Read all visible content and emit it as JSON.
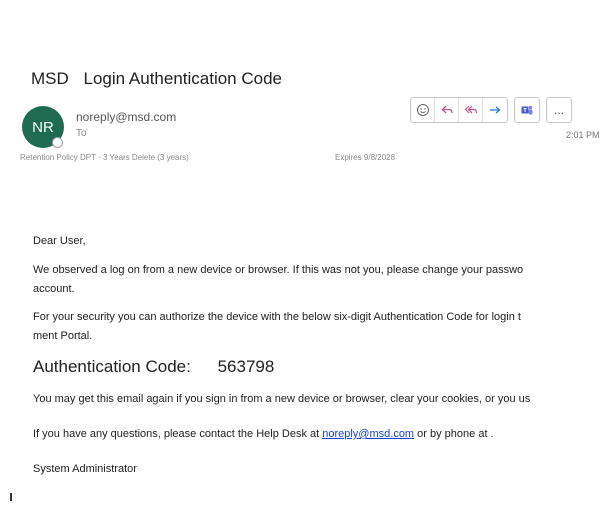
{
  "email": {
    "sender_tag": "MSD",
    "subject": "Login Authentication Code",
    "avatar_initials": "NR",
    "from": "noreply@msd.com",
    "to_label": "To",
    "retention": "Retention Policy  DPT - 3 Years Delete (3 years)",
    "expires": "Expires  9/8/2028",
    "time": "2:01 PM"
  },
  "toolbar": {
    "icons": [
      "emoji-icon",
      "reply-icon",
      "reply-all-icon",
      "forward-icon",
      "teams-icon",
      "more-icon"
    ],
    "more_label": "..."
  },
  "body": {
    "greeting": "Dear User,",
    "line1": "We observed a log on from a new device or browser. If this was not you, please change your passwo",
    "line1b": "account.",
    "line2": "For your security you can authorize the device with the below six-digit Authentication Code for login t",
    "line2b": "ment Portal.",
    "auth_label": "Authentication Code:",
    "auth_code": "563798",
    "line3": "You may get this email again if you sign in from a new device or browser, clear your cookies, or you us",
    "line4_pre": "If you have any questions, please contact the Help Desk at ",
    "line4_link": "noreply@msd.com",
    "line4_post": " or by phone at .",
    "signature": "System Administrator"
  },
  "colors": {
    "avatar": "#1e6b52",
    "link": "#1a3fd6",
    "reply_accent": "#c0508a",
    "forward_accent": "#2b7bd6",
    "teams": "#5059c9"
  }
}
